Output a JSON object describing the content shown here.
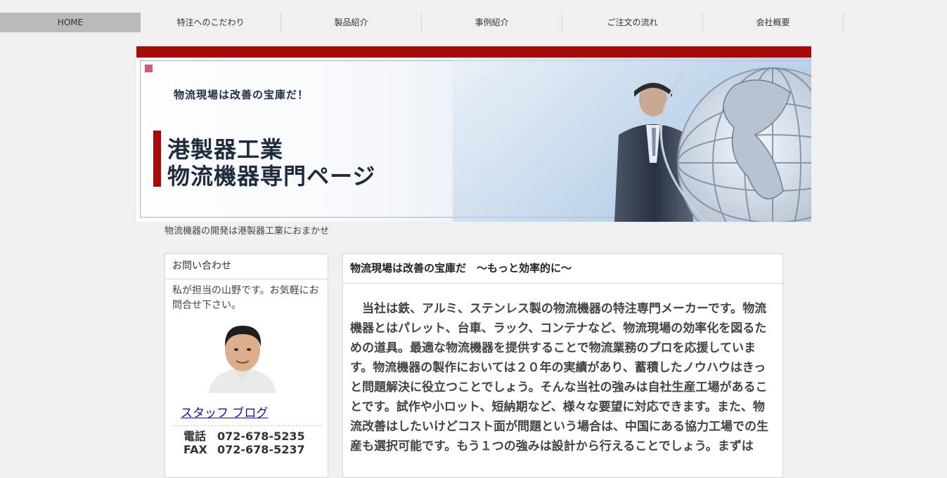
{
  "nav": {
    "items": [
      {
        "label": "HOME"
      },
      {
        "label": "特注へのこだわり"
      },
      {
        "label": "製品紹介"
      },
      {
        "label": "事例紹介"
      },
      {
        "label": "ご注文の流れ"
      },
      {
        "label": "会社概要"
      }
    ]
  },
  "header": {
    "tagline": "物流現場は改善の宝庫だ！",
    "title_line1": "港製器工業",
    "title_line2": "物流機器専門ページ"
  },
  "subtitle": "物流機器の開発は港製器工業におまかせ",
  "sidebar": {
    "title": "お問い合わせ",
    "text": "私が担当の山野です。お気軽にお問合せ下さい。",
    "blog_link": "スタッフ ブログ",
    "tel_label": "電話",
    "tel": "072-678-5235",
    "fax_label": "FAX",
    "fax": "072-678-5237"
  },
  "main": {
    "title": "物流現場は改善の宝庫だ　～もっと効率的に～",
    "body": "当社は鉄、アルミ、ステンレス製の物流機器の特注専門メーカーです。物流機器とはパレット、台車、ラック、コンテナなど、物流現場の効率化を図るための道具。最適な物流機器を提供することで物流業務のプロを応援しています。物流機器の製作においては２０年の実績があり、蓄積したノウハウはきっと問題解決に役立つことでしょう。そんな当社の強みは自社生産工場があることです。試作や小ロット、短納期など、様々な要望に対応できます。また、物流改善はしたいけどコスト面が問題という場合は、中国にある協力工場での生産も選択可能です。もう１つの強みは設計から行えることでしょう。まずは"
  }
}
